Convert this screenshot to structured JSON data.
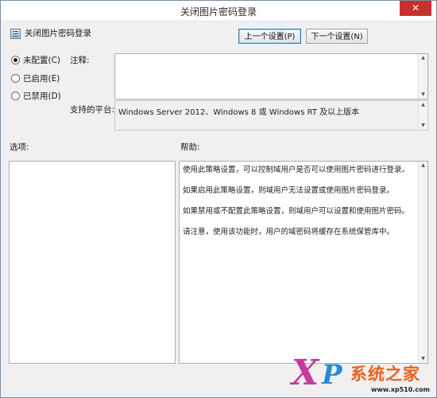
{
  "window": {
    "title": "关闭图片密码登录",
    "close_glyph": "✕"
  },
  "policy": {
    "name": "关闭图片密码登录",
    "icon": "policy-setting-icon"
  },
  "nav": {
    "prev_label": "上一个设置(P)",
    "next_label": "下一个设置(N)"
  },
  "options": [
    {
      "label": "未配置(C)",
      "checked": true
    },
    {
      "label": "已启用(E)",
      "checked": false
    },
    {
      "label": "已禁用(D)",
      "checked": false
    }
  ],
  "labels": {
    "comment": "注释:",
    "supported": "支持的平台:",
    "options": "选项:",
    "help": "帮助:"
  },
  "supported_platforms": "Windows Server 2012、Windows 8 或 Windows RT 及以上版本",
  "help_paragraphs": [
    "使用此策略设置，可以控制域用户是否可以使用图片密码进行登录。",
    "如果启用此策略设置，则域用户无法设置或使用图片密码登录。",
    "如果禁用或不配置此策略设置，则域用户可以设置和使用图片密码。",
    "请注意，使用该功能时，用户的域密码将缓存在系统保管库中。"
  ],
  "watermark": {
    "brand": "系统之家",
    "url": "www.xp510.com"
  },
  "colors": {
    "close_button": "#c7302b",
    "focus_border": "#3c7fb1"
  }
}
